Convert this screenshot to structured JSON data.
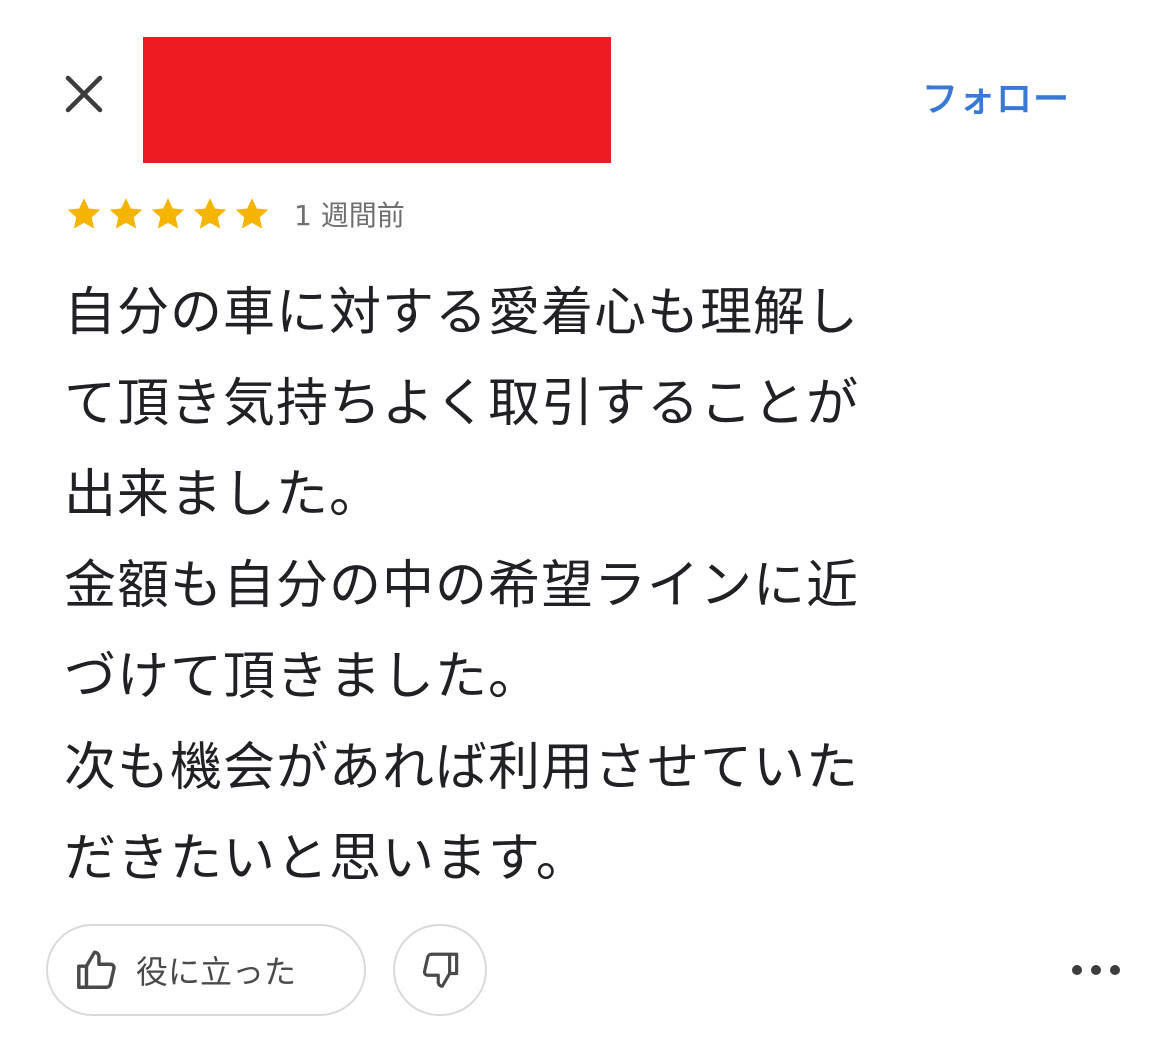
{
  "header": {
    "close_icon": "close-icon",
    "follow_label": "フォロー",
    "follow_color": "#3a78d6",
    "redaction_color": "#ed1c24"
  },
  "review": {
    "rating": 5,
    "rating_max": 5,
    "star_color": "#f4b400",
    "time_ago": "1 週間前",
    "text": "自分の車に対する愛着心も理解し\nて頂き気持ちよく取引することが\n出来ました。\n金額も自分の中の希望ラインに近\nづけて頂きました。\n次も機会があれば利用させていた\nだきたいと思います。"
  },
  "actions": {
    "helpful_label": "役に立った",
    "helpful_icon": "thumbs-up-icon",
    "dislike_icon": "thumbs-down-icon",
    "more_icon": "more-horizontal-icon"
  }
}
